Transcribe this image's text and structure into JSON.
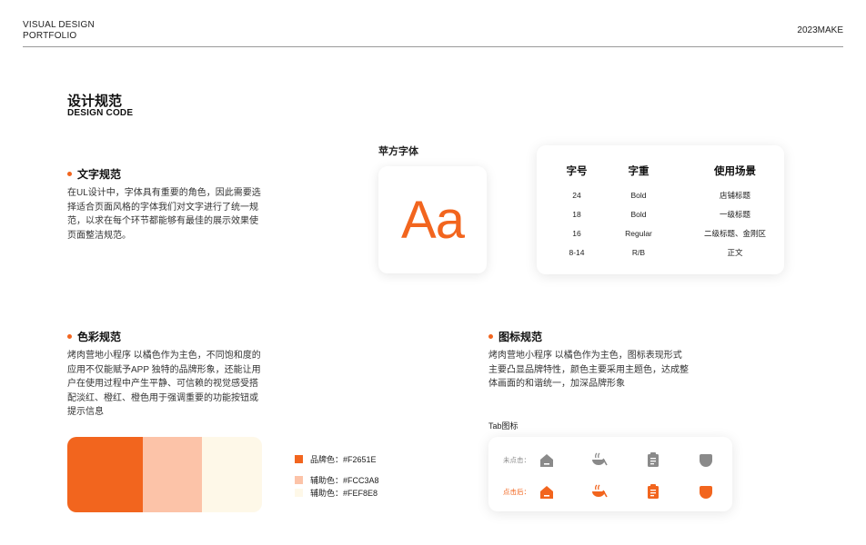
{
  "header": {
    "title_line1": "VISUAL DESIGN",
    "title_line2": "PORTFOLIO",
    "right": "2023MAKE"
  },
  "section": {
    "title": "设计规范",
    "subtitle": "DESIGN CODE"
  },
  "text_spec": {
    "heading": "文字规范",
    "body": "在UL设计中，字体具有重要的角色，因此需要选择适合页面风格的字体我们对文字进行了统一规范，以求在每个环节都能够有最佳的展示效果使页面整洁规范。"
  },
  "font": {
    "label": "苹方字体",
    "sample": "Aa",
    "sample_color": "#F2651E"
  },
  "font_table": {
    "headers": [
      "字号",
      "字重",
      "使用场景"
    ],
    "rows": [
      [
        "24",
        "Bold",
        "店铺标题"
      ],
      [
        "18",
        "Bold",
        "一级标题"
      ],
      [
        "16",
        "Regular",
        "二级标题、金刚区"
      ],
      [
        "8-14",
        "R/B",
        "正文"
      ]
    ]
  },
  "color_spec": {
    "heading": "色彩规范",
    "body": "烤肉营地小程序 以橘色作为主色，不同饱和度的应用不仅能赋予APP 独特的品牌形象，还能让用户在使用过程中产生平静、可信赖的视觉感受搭配淡红、橙红、橙色用于强调重要的功能按钮或提示信息"
  },
  "palette": [
    {
      "label": "品牌色：#F2651E",
      "hex": "#F2651E"
    },
    {
      "label": "辅助色：#FCC3A8",
      "hex": "#FCC3A8"
    },
    {
      "label": "辅助色：#FEF8E8",
      "hex": "#FEF8E8"
    }
  ],
  "icon_spec": {
    "heading": "图标规范",
    "body": "烤肉营地小程序 以橘色作为主色，图标表现形式主要凸显品牌特性，颜色主要采用主题色，达成整体画面的和谐统一，加深品牌形象",
    "tab_label": "Tab图标",
    "row_unclicked": "未点击：",
    "row_clicked": "点击后：",
    "inactive_color": "#8a8a8a",
    "active_color": "#F2651E",
    "icons": [
      "home-icon",
      "bowl-icon",
      "clipboard-icon",
      "profile-icon"
    ]
  }
}
